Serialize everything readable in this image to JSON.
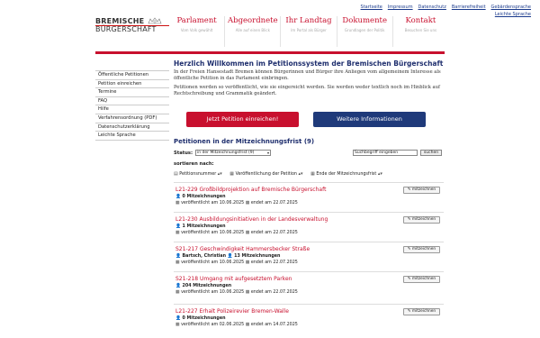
{
  "top_links": [
    "Startseite",
    "Impressum",
    "Datenschutz",
    "Barrierefreiheit",
    "Gebärdensprache",
    "Leichte Sprache"
  ],
  "logo": {
    "line1": "BREMISCHE",
    "line2": "BÜRGERSCHAFT"
  },
  "main_nav": [
    {
      "title": "Parlament",
      "subtitle": "Vom Volk gewählt"
    },
    {
      "title": "Abgeordnete",
      "subtitle": "Alle auf einen Blick"
    },
    {
      "title": "Ihr Landtag",
      "subtitle": "Im Portal als Bürger"
    },
    {
      "title": "Dokumente",
      "subtitle": "Grundlagen der Politik"
    },
    {
      "title": "Kontakt",
      "subtitle": "Besuchen Sie uns"
    }
  ],
  "sidebar": [
    "Öffentliche Petitionen",
    "Petition einreichen",
    "Termine",
    "FAQ",
    "Hilfe",
    "Verfahrensordnung (PDF)",
    "Datenschutzerklärung",
    "Leichte Sprache"
  ],
  "welcome": {
    "heading": "Herzlich Willkommen im Petitionssystem der Bremischen Bürgerschaft",
    "para1": "In der Freien Hansestadt Bremen können Bürgerinnen und Bürger ihre Anliegen vom allgemeinem Interesse als öffentliche Petition in das Parlament einbringen.",
    "para2": "Petitionen werden so veröffentlicht, wie sie eingereicht werden. Sie werden weder textlich noch im Hinblick auf Rechtschreibung und Grammatik geändert."
  },
  "buttons": {
    "submit": "Jetzt Petition einreichen!",
    "info": "Weitere Informationen"
  },
  "list": {
    "heading": "Petitionen in der Mitzeichnungsfrist (9)",
    "status_label": "Status:",
    "status_value": "in der Mitzeichnungsfrist (9)",
    "search_placeholder": "Suchbegriff eingeben",
    "search_button": "suchen",
    "sort_title": "sortieren nach:",
    "sort_options": [
      "Petitionsnummer",
      "Veröffentlichung der Petition",
      "Ende der Mitzeichnungsfrist"
    ],
    "sign_label": "mitzeichnen"
  },
  "petitions": [
    {
      "title": "L21-229 Großbildprojektion auf Bremische Bürgerschaft",
      "author": "",
      "signatures": "0 Mitzeichnungen",
      "published": "veröffentlicht am 10.06.2025",
      "ends": "endet am 22.07.2025"
    },
    {
      "title": "L21-230 Ausbildungsinitiativen in der Landesverwaltung",
      "author": "",
      "signatures": "1 Mitzeichnungen",
      "published": "veröffentlicht am 10.06.2025",
      "ends": "endet am 22.07.2025"
    },
    {
      "title": "S21-217 Geschwindigkeit Hammersbecker Straße",
      "author": "Bartsch, Christian",
      "signatures": "13 Mitzeichnungen",
      "published": "veröffentlicht am 10.06.2025",
      "ends": "endet am 22.07.2025"
    },
    {
      "title": "S21-218 Umgang mit aufgesetztem Parken",
      "author": "",
      "signatures": "204 Mitzeichnungen",
      "published": "veröffentlicht am 10.06.2025",
      "ends": "endet am 22.07.2025"
    },
    {
      "title": "L21-227 Erhalt Polizeirevier Bremen-Walle",
      "author": "",
      "signatures": "0 Mitzeichnungen",
      "published": "veröffentlicht am 02.06.2025",
      "ends": "endet am 14.07.2025"
    }
  ],
  "icons": {
    "person": "person-icon",
    "calendar": "calendar-icon",
    "pencil": "pencil-icon",
    "sort": "sort-arrows-icon"
  },
  "colors": {
    "brand_red": "#c8102e",
    "brand_blue": "#1f3a7a",
    "heading_blue": "#1f2f6e"
  }
}
